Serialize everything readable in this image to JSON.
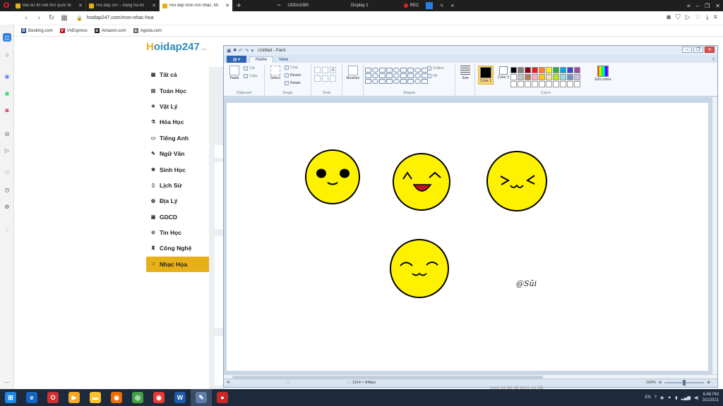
{
  "browser": {
    "tabs": [
      {
        "label": "Bài dự thi viết thư quốc tế",
        "color": "#e8b018"
      },
      {
        "label": "Hỏi đáp 247 - trang tra lời",
        "color": "#e8b018"
      },
      {
        "label": "Hỏi đáp môn Âm nhạc, Mĩ",
        "color": "#e8b018",
        "active": true
      }
    ],
    "new_tab": "+",
    "recorder": {
      "resolution": "1920x1080",
      "display": "Display 1",
      "rec": "REC"
    },
    "url": "hoidap247.com/mon-nhac-hoa",
    "bookmarks": [
      {
        "label": "Booking.com",
        "letter": "B",
        "color": "#1a3a8a"
      },
      {
        "label": "VnExpress",
        "letter": "V",
        "color": "#b5121b"
      },
      {
        "label": "Amazon.com",
        "letter": "a",
        "color": "#222222"
      },
      {
        "label": "Agoda.com",
        "letter": "a",
        "color": "#666666"
      }
    ]
  },
  "site": {
    "logo_main": "oidap",
    "logo_h": "H",
    "logo_num": "247",
    "logo_small": ".com",
    "menu": [
      {
        "label": "Tất cả",
        "icon": "▦"
      },
      {
        "label": "Toán Học",
        "icon": "▤"
      },
      {
        "label": "Vật Lý",
        "icon": "⚛"
      },
      {
        "label": "Hóa Học",
        "icon": "⚗"
      },
      {
        "label": "Tiếng Anh",
        "icon": "▭"
      },
      {
        "label": "Ngữ Văn",
        "icon": "✎"
      },
      {
        "label": "Sinh Học",
        "icon": "✱"
      },
      {
        "label": "Lịch Sử",
        "icon": "▯"
      },
      {
        "label": "Địa Lý",
        "icon": "◍"
      },
      {
        "label": "GDCD",
        "icon": "▣"
      },
      {
        "label": "Tin Học",
        "icon": "⊘"
      },
      {
        "label": "Công Nghệ",
        "icon": "♜"
      },
      {
        "label": "Nhạc Họa",
        "icon": "♫",
        "active": true
      }
    ]
  },
  "paint": {
    "title": "Untitled - Paint",
    "tabs": [
      "Home",
      "View"
    ],
    "groups": {
      "clipboard": "Clipboard",
      "image": "Image",
      "tools": "Tools",
      "shapes": "Shapes",
      "colors": "Colors"
    },
    "buttons": {
      "paste": "Paste",
      "cut": "Cut",
      "copy": "Copy",
      "select": "Select",
      "crop": "Crop",
      "resize": "Resize",
      "rotate": "Rotate",
      "brushes": "Brushes",
      "outline": "Outline",
      "fill": "Fill",
      "size": "Size",
      "color1": "Color 1",
      "color2": "Color 2",
      "edit_colors": "Edit colors"
    },
    "color1": "#000000",
    "color2": "#ffffff",
    "palette": [
      "#000000",
      "#7f7f7f",
      "#880015",
      "#ed1c24",
      "#ff7f27",
      "#fff200",
      "#22b14c",
      "#00a2e8",
      "#3f48cc",
      "#a349a4",
      "#ffffff",
      "#c3c3c3",
      "#b97a57",
      "#ffaec9",
      "#ffc90e",
      "#efe4b0",
      "#b5e61d",
      "#99d9ea",
      "#7092be",
      "#c8bfe7",
      "#ffffff",
      "#ffffff",
      "#ffffff",
      "#ffffff",
      "#ffffff",
      "#ffffff",
      "#ffffff",
      "#ffffff",
      "#ffffff",
      "#ffffff"
    ],
    "signature": "@Sûi",
    "canvas_size": "1914 × 848px",
    "zoom": "100%",
    "emoji_color": "#fff200"
  },
  "background_text": "trong 24 giờ để được ưu đãi",
  "taskbar": {
    "apps": [
      {
        "name": "start",
        "color": "#1e88e5",
        "glyph": "⊞"
      },
      {
        "name": "ie",
        "color": "#1565c0",
        "glyph": "e"
      },
      {
        "name": "opera",
        "color": "#d32f2f",
        "glyph": "O"
      },
      {
        "name": "media",
        "color": "#f9a825",
        "glyph": "▶"
      },
      {
        "name": "explorer",
        "color": "#fbc02d",
        "glyph": "▬"
      },
      {
        "name": "firefox",
        "color": "#ef6c00",
        "glyph": "◉"
      },
      {
        "name": "app",
        "color": "#43a047",
        "glyph": "◎"
      },
      {
        "name": "chrome",
        "color": "#e53935",
        "glyph": "◉"
      },
      {
        "name": "word",
        "color": "#1e5aa8",
        "glyph": "W"
      },
      {
        "name": "paint",
        "color": "#5d7da8",
        "glyph": "✎"
      },
      {
        "name": "recorder",
        "color": "#c62828",
        "glyph": "●"
      }
    ],
    "lang": "EN",
    "time": "6:46 PM",
    "date": "3/1/2021"
  }
}
